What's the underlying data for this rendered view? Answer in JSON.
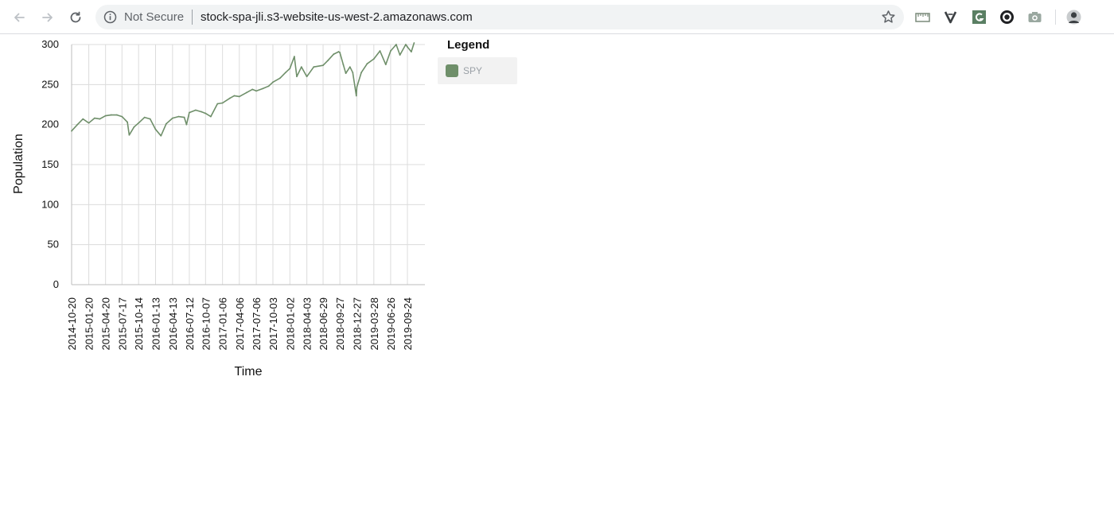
{
  "browser": {
    "security_label": "Not Secure",
    "url": "stock-spa-jli.s3-website-us-west-2.amazonaws.com",
    "nav_icons": [
      "back-arrow-icon",
      "forward-arrow-icon",
      "reload-icon"
    ],
    "extension_icons": [
      "ruler-extension-icon",
      "vimium-extension-icon",
      "grammarly-extension-icon",
      "privacy-extension-icon",
      "camera-extension-icon",
      "profile-avatar-icon"
    ]
  },
  "legend": {
    "title": "Legend",
    "items": [
      {
        "label": "SPY",
        "color": "#6f8f6a"
      }
    ]
  },
  "chart_data": {
    "type": "line",
    "xlabel": "Time",
    "ylabel": "Population",
    "ylim": [
      0,
      300
    ],
    "yticks": [
      0,
      50,
      100,
      150,
      200,
      250,
      300
    ],
    "xticks": [
      "2014-10-20",
      "2015-01-20",
      "2015-04-20",
      "2015-07-17",
      "2015-10-14",
      "2016-01-13",
      "2016-04-13",
      "2016-07-12",
      "2016-10-07",
      "2017-01-06",
      "2017-04-06",
      "2017-07-06",
      "2017-10-03",
      "2018-01-02",
      "2018-04-03",
      "2018-06-29",
      "2018-09-27",
      "2018-12-27",
      "2019-03-28",
      "2019-06-26",
      "2019-09-24"
    ],
    "grid": true,
    "legend_position": "right",
    "series": [
      {
        "name": "SPY",
        "color": "#6f8f6a",
        "x": [
          "2014-10-20",
          "2014-11-20",
          "2014-12-20",
          "2015-01-20",
          "2015-02-20",
          "2015-03-20",
          "2015-04-20",
          "2015-05-20",
          "2015-06-20",
          "2015-07-17",
          "2015-08-15",
          "2015-08-25",
          "2015-09-20",
          "2015-10-14",
          "2015-11-15",
          "2015-12-15",
          "2016-01-13",
          "2016-02-11",
          "2016-03-10",
          "2016-04-13",
          "2016-05-15",
          "2016-06-15",
          "2016-06-27",
          "2016-07-12",
          "2016-08-15",
          "2016-09-15",
          "2016-10-07",
          "2016-11-04",
          "2016-12-10",
          "2017-01-06",
          "2017-02-15",
          "2017-03-10",
          "2017-04-06",
          "2017-05-15",
          "2017-06-15",
          "2017-07-06",
          "2017-08-10",
          "2017-09-10",
          "2017-10-03",
          "2017-11-10",
          "2017-12-10",
          "2018-01-02",
          "2018-01-26",
          "2018-02-08",
          "2018-03-05",
          "2018-04-03",
          "2018-05-10",
          "2018-06-29",
          "2018-07-25",
          "2018-08-25",
          "2018-09-20",
          "2018-09-27",
          "2018-10-15",
          "2018-10-29",
          "2018-11-20",
          "2018-12-05",
          "2018-12-24",
          "2018-12-27",
          "2019-01-20",
          "2019-02-20",
          "2019-03-28",
          "2019-04-30",
          "2019-05-31",
          "2019-06-26",
          "2019-07-26",
          "2019-08-15",
          "2019-09-15",
          "2019-09-24",
          "2019-10-15",
          "2019-10-30"
        ],
        "values": [
          192,
          200,
          207,
          202,
          208,
          207,
          211,
          212,
          212,
          210,
          203,
          187,
          197,
          202,
          209,
          207,
          194,
          186,
          201,
          208,
          210,
          209,
          200,
          215,
          218,
          216,
          214,
          210,
          226,
          227,
          233,
          236,
          235,
          240,
          244,
          242,
          245,
          248,
          253,
          258,
          265,
          270,
          285,
          260,
          272,
          260,
          272,
          274,
          280,
          288,
          291,
          290,
          275,
          264,
          272,
          265,
          236,
          247,
          265,
          276,
          282,
          292,
          275,
          292,
          300,
          287,
          300,
          297,
          291,
          302
        ]
      }
    ]
  }
}
